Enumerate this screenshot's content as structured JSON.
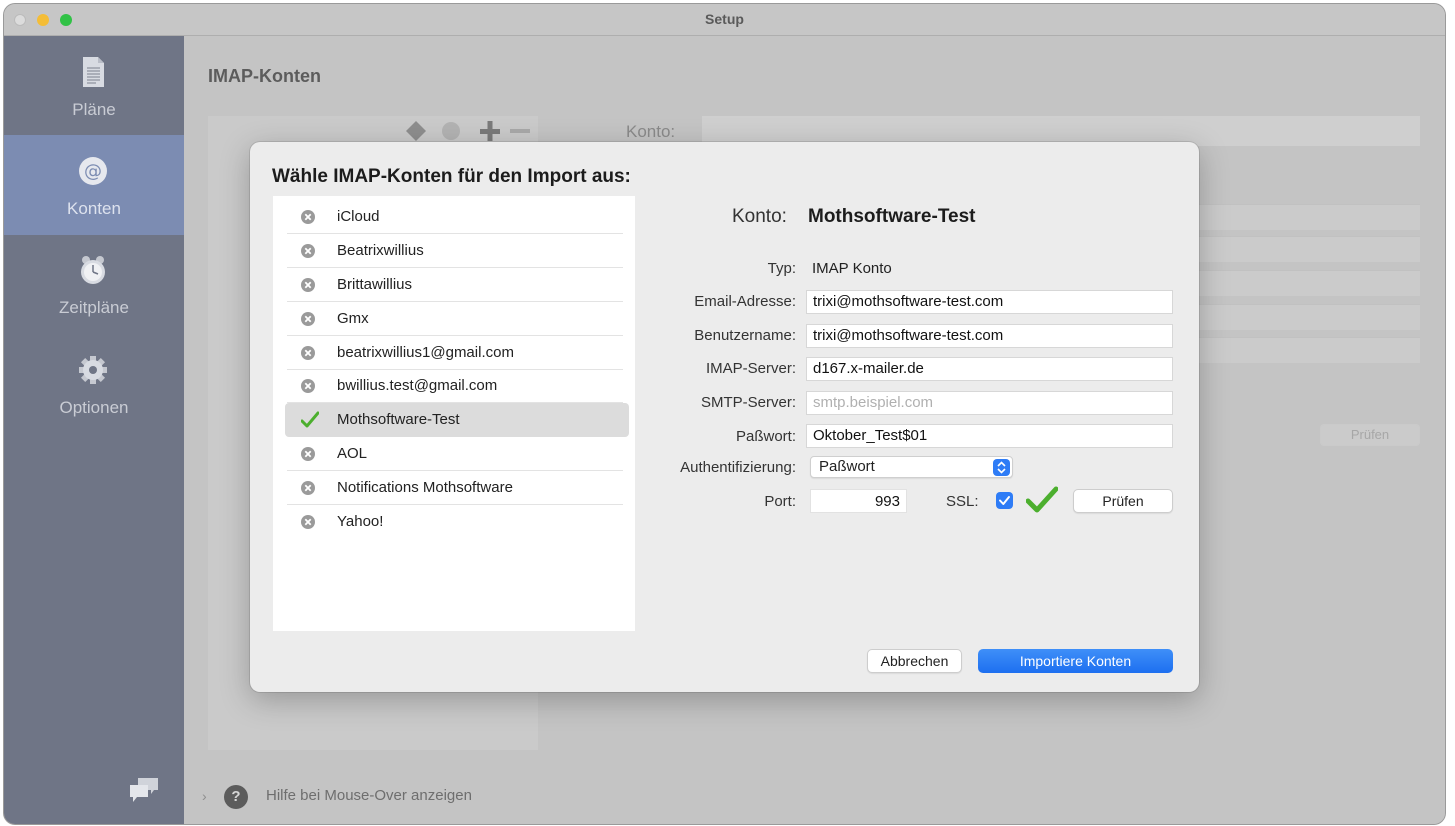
{
  "window": {
    "title": "Setup"
  },
  "sidebar": {
    "items": [
      {
        "label": "Pläne",
        "icon": "document-icon"
      },
      {
        "label": "Konten",
        "icon": "at-sign-icon"
      },
      {
        "label": "Zeitpläne",
        "icon": "alarm-clock-icon"
      },
      {
        "label": "Optionen",
        "icon": "gear-icon"
      }
    ],
    "active_index": 1,
    "footer_icon": "chat-bubbles-icon"
  },
  "content": {
    "title": "IMAP-Konten",
    "konto_label": "Konto:",
    "pruefen_label": "Prüfen"
  },
  "bottom": {
    "help_text": "Hilfe bei Mouse-Over anzeigen"
  },
  "dialog": {
    "title": "Wähle IMAP-Konten für den Import aus:",
    "accounts": [
      {
        "label": "iCloud",
        "selected": false
      },
      {
        "label": "Beatrixwillius",
        "selected": false
      },
      {
        "label": "Brittawillius",
        "selected": false
      },
      {
        "label": "Gmx",
        "selected": false
      },
      {
        "label": "beatrixwillius1@gmail.com",
        "selected": false
      },
      {
        "label": "bwillius.test@gmail.com",
        "selected": false
      },
      {
        "label": "Mothsoftware-Test",
        "selected": true
      },
      {
        "label": "AOL",
        "selected": false
      },
      {
        "label": "Notifications Mothsoftware",
        "selected": false
      },
      {
        "label": "Yahoo!",
        "selected": false
      }
    ],
    "detail": {
      "konto_label": "Konto:",
      "konto_value": "Mothsoftware-Test",
      "typ_label": "Typ:",
      "typ_value": "IMAP Konto",
      "email_label": "Email-Adresse:",
      "email_value": "trixi@mothsoftware-test.com",
      "user_label": "Benutzername:",
      "user_value": "trixi@mothsoftware-test.com",
      "imap_label": "IMAP-Server:",
      "imap_value": "d167.x-mailer.de",
      "smtp_label": "SMTP-Server:",
      "smtp_placeholder": "smtp.beispiel.com",
      "password_label": "Paßwort:",
      "password_value": "Oktober_Test$01",
      "auth_label": "Authentifizierung:",
      "auth_value": "Paßwort",
      "port_label": "Port:",
      "port_value": "993",
      "ssl_label": "SSL:",
      "ssl_checked": true,
      "pruefen_label": "Prüfen"
    },
    "cancel_label": "Abbrechen",
    "import_label": "Importiere Konten"
  },
  "colors": {
    "accent": "#2e7cf6",
    "sidebar": "#6f7586",
    "sidebar_active": "#7c8cb2",
    "check_green": "#4caf2e"
  }
}
